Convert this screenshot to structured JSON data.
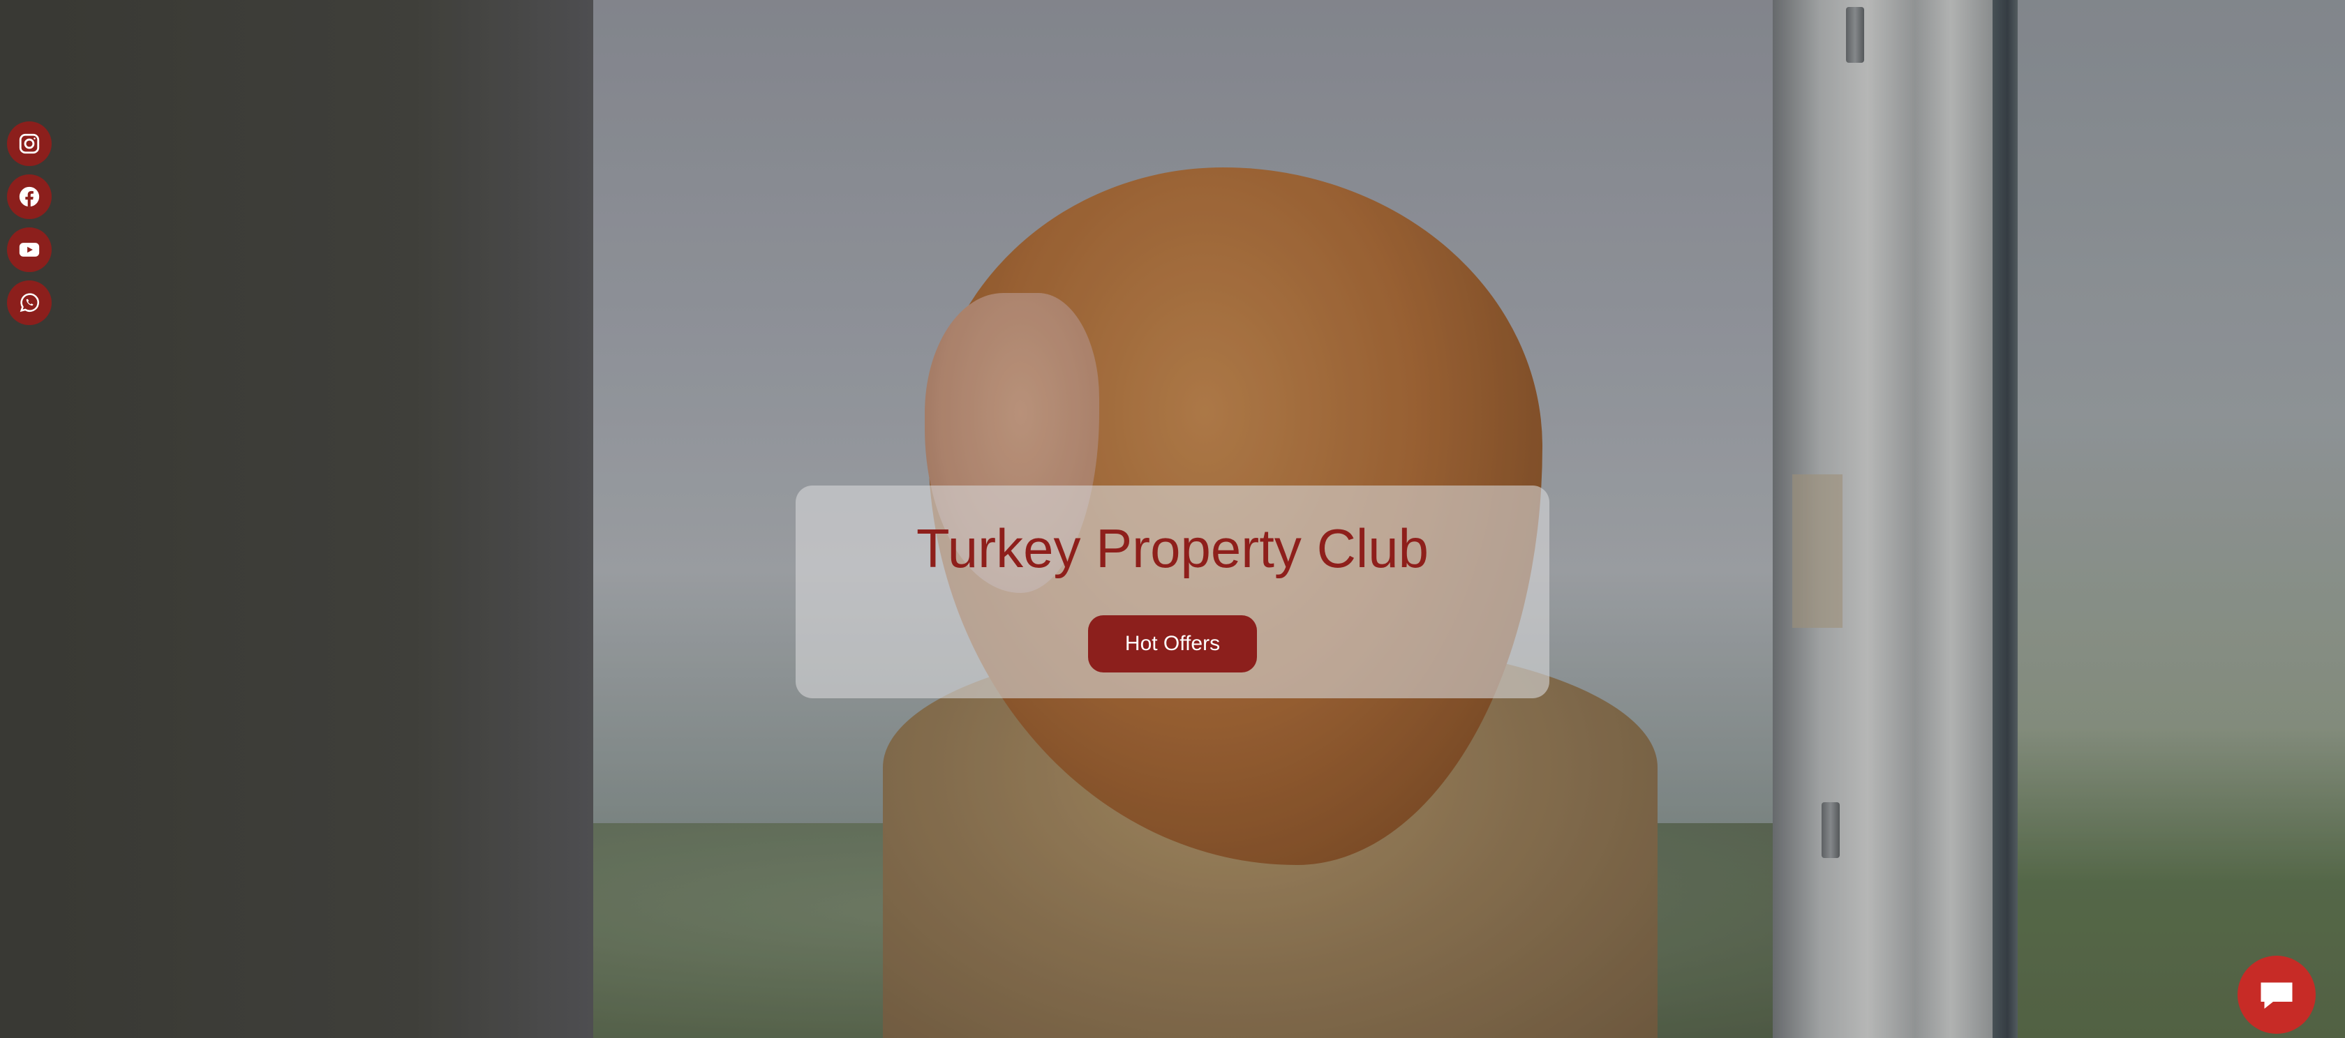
{
  "hero": {
    "title": "Turkey Property Club",
    "cta_label": "Hot Offers"
  },
  "social": [
    {
      "name": "instagram",
      "icon": "instagram-icon"
    },
    {
      "name": "facebook",
      "icon": "facebook-icon"
    },
    {
      "name": "youtube",
      "icon": "youtube-icon"
    },
    {
      "name": "whatsapp",
      "icon": "whatsapp-icon"
    }
  ],
  "chat": {
    "icon": "chat-bubble-icon"
  },
  "colors": {
    "brand": "#8c1f1c",
    "title": "#8e1f1b",
    "chat": "#c72b26",
    "card": "#d7d7d9"
  }
}
